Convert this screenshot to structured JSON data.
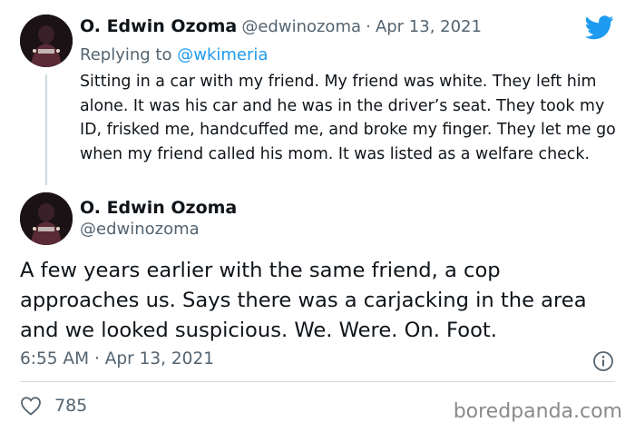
{
  "reply_tweet": {
    "author_name": "O. Edwin Ozoma",
    "handle": "@edwinozoma",
    "separator": "·",
    "date": "Apr 13, 2021",
    "replying_prefix": "Replying to",
    "replying_to": "@wkimeria",
    "text": "Sitting in a car with my friend. My friend was white. They left him alone. It was his car and he was in the driver’s seat. They took my ID, frisked me, handcuffed me, and broke my finger. They let me go when my friend called his mom. It was listed as a welfare check."
  },
  "main_tweet": {
    "author_name": "O. Edwin Ozoma",
    "handle": "@edwinozoma",
    "text": "A few years earlier with the same friend, a cop approaches us. Says there was a carjacking in the area and we looked suspicious. We. Were. On. Foot.",
    "time": "6:55 AM",
    "separator": "·",
    "date": "Apr 13, 2021",
    "like_count": "785"
  },
  "watermark": "boredpanda.com",
  "colors": {
    "twitter_blue": "#1d9bf0",
    "text": "#0f1419",
    "muted": "#536471",
    "divider": "#cfd9de"
  },
  "icons": {
    "brand": "twitter-bird-icon",
    "info": "info-icon",
    "like": "heart-icon"
  }
}
